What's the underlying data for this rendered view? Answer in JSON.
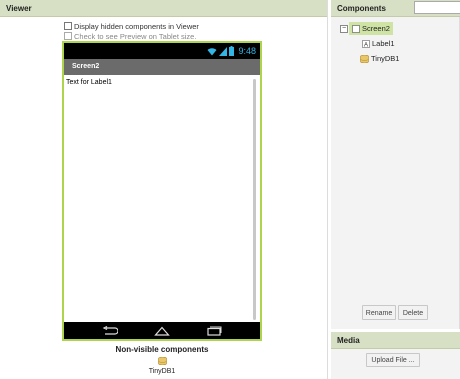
{
  "viewer": {
    "title": "Viewer",
    "option_hidden": "Display hidden components in Viewer",
    "option_tablet": "Check to see Preview on Tablet size.",
    "phone": {
      "status_time": "9:48",
      "screen_title": "Screen2",
      "label_text": "Text for Label1"
    },
    "nonvisible_title": "Non-visible components",
    "nonvisible_items": [
      "TinyDB1"
    ]
  },
  "components": {
    "title": "Components",
    "tree": {
      "screen": "Screen2",
      "children": [
        "Label1",
        "TinyDB1"
      ]
    },
    "rename_label": "Rename",
    "delete_label": "Delete"
  },
  "media": {
    "title": "Media",
    "upload_label": "Upload File ..."
  },
  "colors": {
    "header_bg": "#d7e0c5",
    "phone_border": "#aed34d",
    "selected_bg": "#cfe3a4",
    "status_time": "#33b5e5"
  }
}
